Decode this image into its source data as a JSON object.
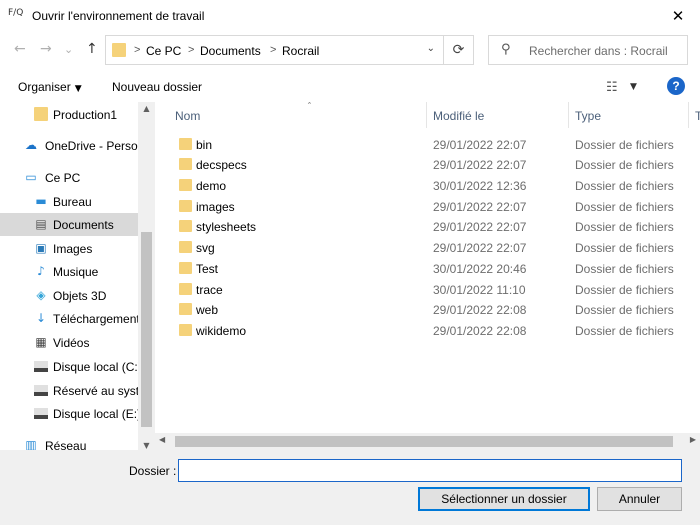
{
  "window": {
    "title_icon": "F/Q",
    "title": "Ouvrir l'environnement de travail",
    "close_glyph": "✕"
  },
  "nav": {
    "back_icon": "←",
    "forward_icon": "→",
    "dropdown_icon": "⌄",
    "up_icon": "↑"
  },
  "address": {
    "parts": [
      "Ce PC",
      "Documents",
      "Rocrail"
    ],
    "separator": ">"
  },
  "search": {
    "placeholder": "Rechercher dans : Rocrail"
  },
  "toolbar": {
    "organize_label": "Organiser",
    "new_folder_label": "Nouveau dossier",
    "dropdown_glyph": "▼"
  },
  "sidebar": {
    "items": [
      {
        "label": "Production1",
        "icon": "folder-icon"
      },
      {
        "label": "OneDrive - Perso",
        "icon": "cloud-icon"
      },
      {
        "label": "Ce PC",
        "icon": "computer-icon"
      },
      {
        "label": "Bureau",
        "icon": "desktop-icon"
      },
      {
        "label": "Documents",
        "icon": "documents-icon",
        "selected": true
      },
      {
        "label": "Images",
        "icon": "images-icon"
      },
      {
        "label": "Musique",
        "icon": "music-icon"
      },
      {
        "label": "Objets 3D",
        "icon": "objects-3d-icon"
      },
      {
        "label": "Téléchargements",
        "icon": "downloads-icon"
      },
      {
        "label": "Vidéos",
        "icon": "videos-icon"
      },
      {
        "label": "Disque local (C:)",
        "icon": "drive-icon"
      },
      {
        "label": "Réservé au système",
        "icon": "drive-icon"
      },
      {
        "label": "Disque local (E:)",
        "icon": "drive-icon"
      },
      {
        "label": "Réseau",
        "icon": "network-icon"
      }
    ]
  },
  "columns": {
    "name": "Nom",
    "modified": "Modifié le",
    "type": "Type",
    "size": "T"
  },
  "files": [
    {
      "name": "bin",
      "modified": "29/01/2022 22:07",
      "type": "Dossier de fichiers"
    },
    {
      "name": "decspecs",
      "modified": "29/01/2022 22:07",
      "type": "Dossier de fichiers"
    },
    {
      "name": "demo",
      "modified": "30/01/2022 12:36",
      "type": "Dossier de fichiers"
    },
    {
      "name": "images",
      "modified": "29/01/2022 22:07",
      "type": "Dossier de fichiers"
    },
    {
      "name": "stylesheets",
      "modified": "29/01/2022 22:07",
      "type": "Dossier de fichiers"
    },
    {
      "name": "svg",
      "modified": "29/01/2022 22:07",
      "type": "Dossier de fichiers"
    },
    {
      "name": "Test",
      "modified": "30/01/2022 20:46",
      "type": "Dossier de fichiers"
    },
    {
      "name": "trace",
      "modified": "30/01/2022 11:10",
      "type": "Dossier de fichiers"
    },
    {
      "name": "web",
      "modified": "29/01/2022 22:08",
      "type": "Dossier de fichiers"
    },
    {
      "name": "wikidemo",
      "modified": "29/01/2022 22:08",
      "type": "Dossier de fichiers"
    }
  ],
  "bottom": {
    "folder_label": "Dossier :",
    "folder_value": "",
    "select_label": "Sélectionner un dossier",
    "cancel_label": "Annuler"
  },
  "colors": {
    "accent": "#0078d7",
    "folder": "#f5d27a",
    "selection": "#d9d9d9",
    "header_text": "#4c607a"
  }
}
